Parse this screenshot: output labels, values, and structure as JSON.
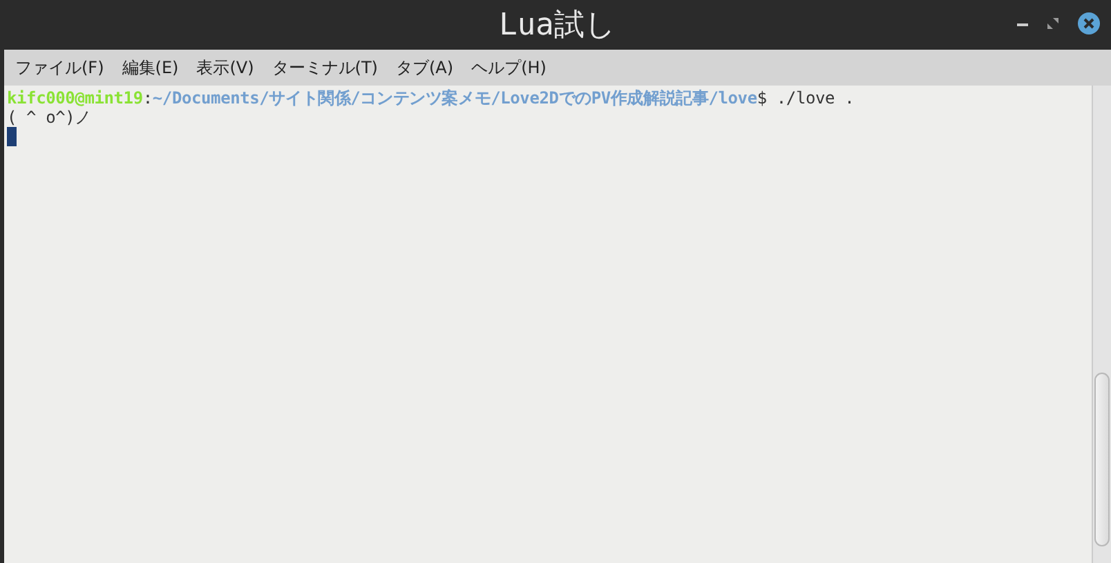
{
  "window": {
    "title": "Lua試し"
  },
  "menu": [
    "ファイル(F)",
    "編集(E)",
    "表示(V)",
    "ターミナル(T)",
    "タブ(A)",
    "ヘルプ(H)"
  ],
  "terminal": {
    "prompt": {
      "user": "kifc000@mint19",
      "separator": ":",
      "path": "~/Documents/サイト関係/コンテンツ案メモ/Love2DでのPV作成解説記事/love",
      "command": "$ ./love ."
    },
    "output": [
      "( ^ o^)ノ"
    ]
  }
}
